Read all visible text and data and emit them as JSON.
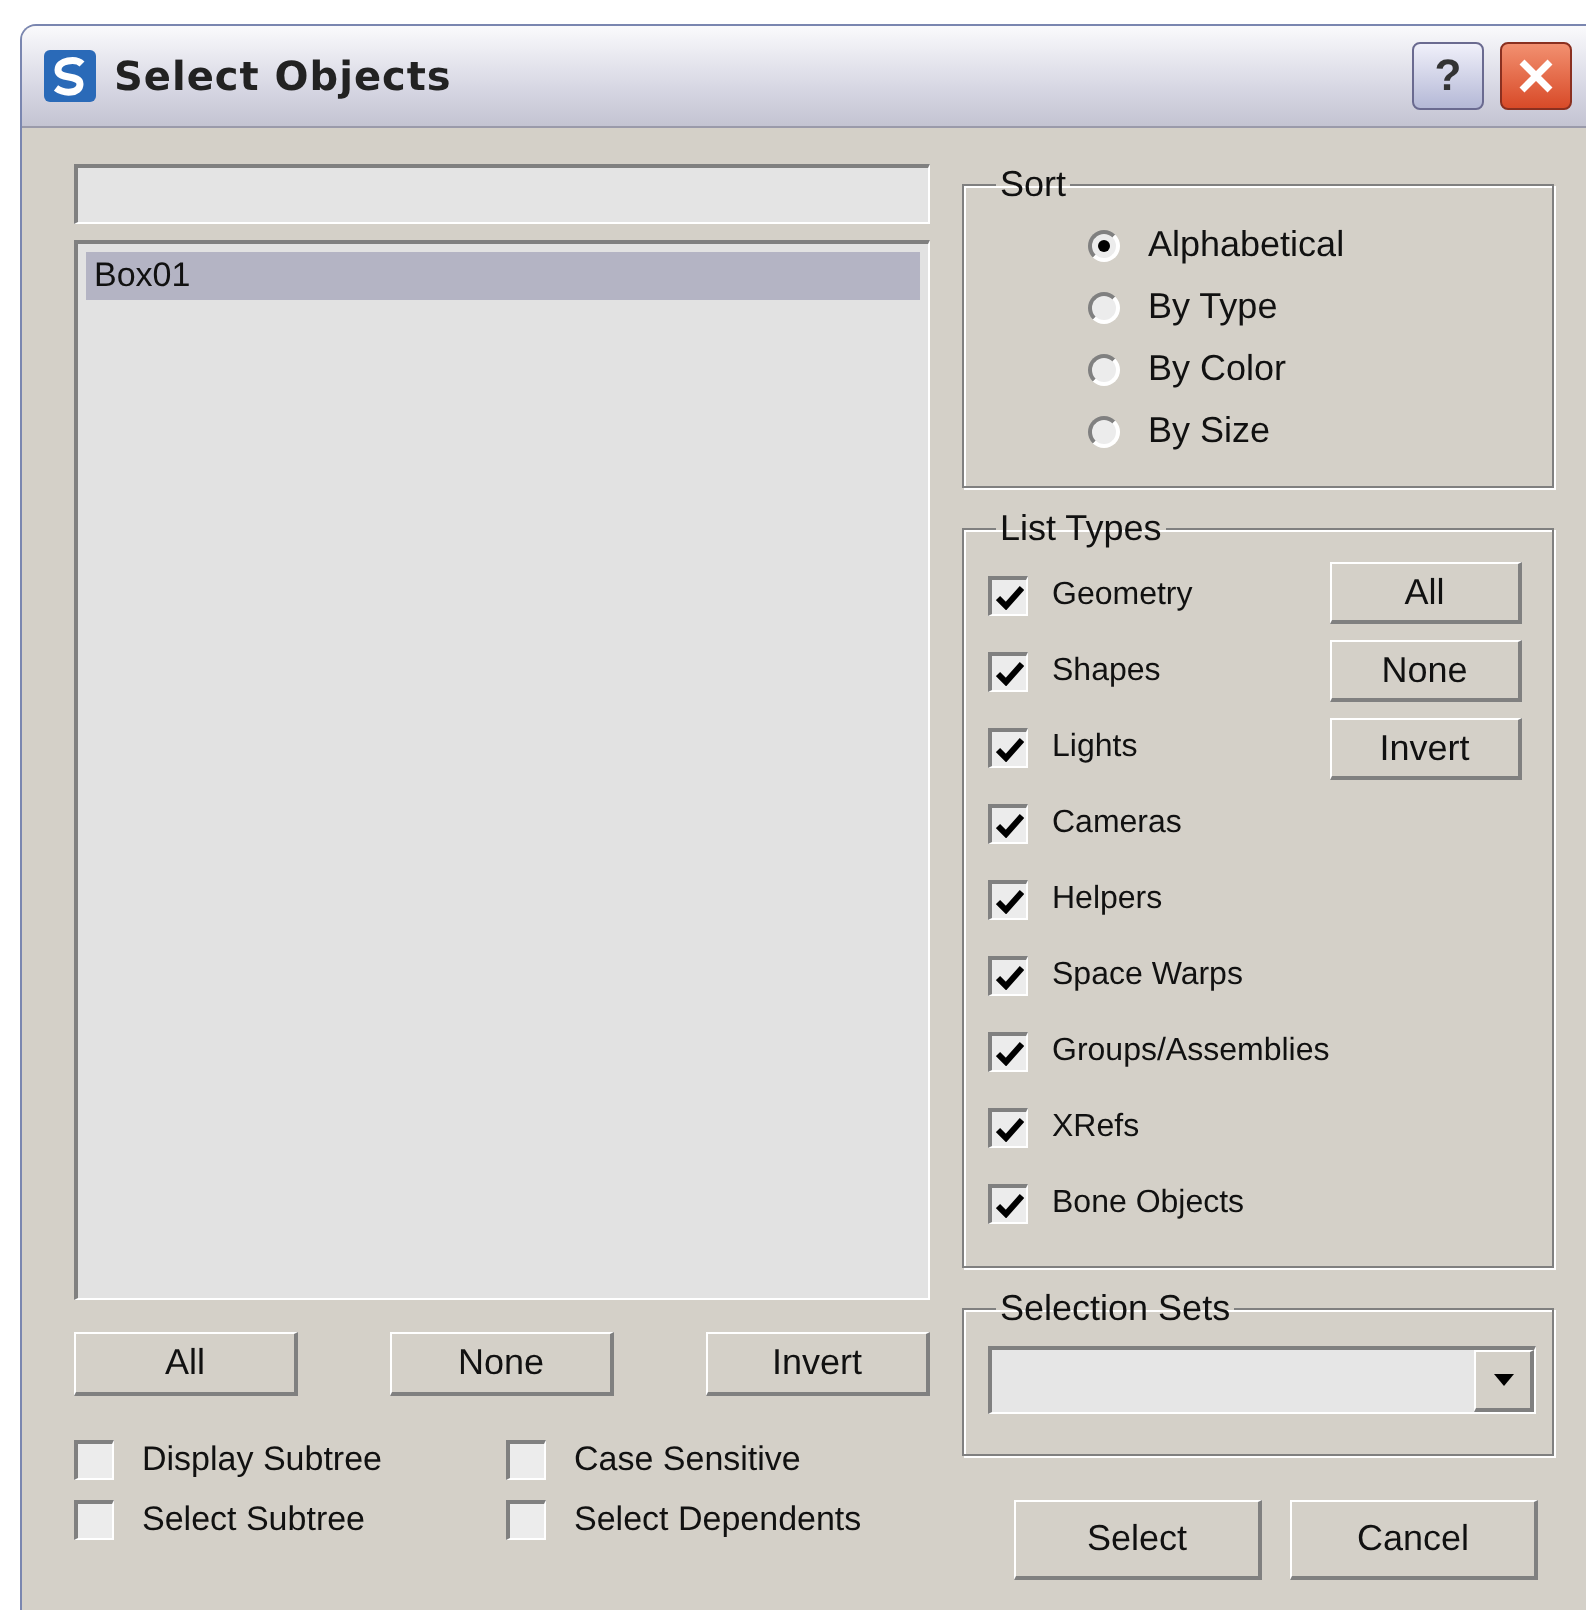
{
  "window": {
    "title": "Select Objects",
    "help": "?"
  },
  "objects": [
    {
      "name": "Box01",
      "selected": true
    }
  ],
  "list_buttons": [
    "All",
    "None",
    "Invert"
  ],
  "options": [
    {
      "label": "Display Subtree",
      "checked": false
    },
    {
      "label": "Case Sensitive",
      "checked": false
    },
    {
      "label": "Select Subtree",
      "checked": false
    },
    {
      "label": "Select Dependents",
      "checked": false
    }
  ],
  "sort": {
    "title": "Sort",
    "options": [
      {
        "label": "Alphabetical",
        "selected": true
      },
      {
        "label": "By Type",
        "selected": false
      },
      {
        "label": "By Color",
        "selected": false
      },
      {
        "label": "By Size",
        "selected": false
      }
    ]
  },
  "list_types": {
    "title": "List Types",
    "items": [
      {
        "label": "Geometry",
        "checked": true
      },
      {
        "label": "Shapes",
        "checked": true
      },
      {
        "label": "Lights",
        "checked": true
      },
      {
        "label": "Cameras",
        "checked": true
      },
      {
        "label": "Helpers",
        "checked": true
      },
      {
        "label": "Space Warps",
        "checked": true
      },
      {
        "label": "Groups/Assemblies",
        "checked": true
      },
      {
        "label": "XRefs",
        "checked": true
      },
      {
        "label": "Bone Objects",
        "checked": true
      }
    ],
    "buttons": [
      "All",
      "None",
      "Invert"
    ]
  },
  "selection_sets": {
    "title": "Selection Sets"
  },
  "footer_buttons": [
    "Select",
    "Cancel"
  ]
}
